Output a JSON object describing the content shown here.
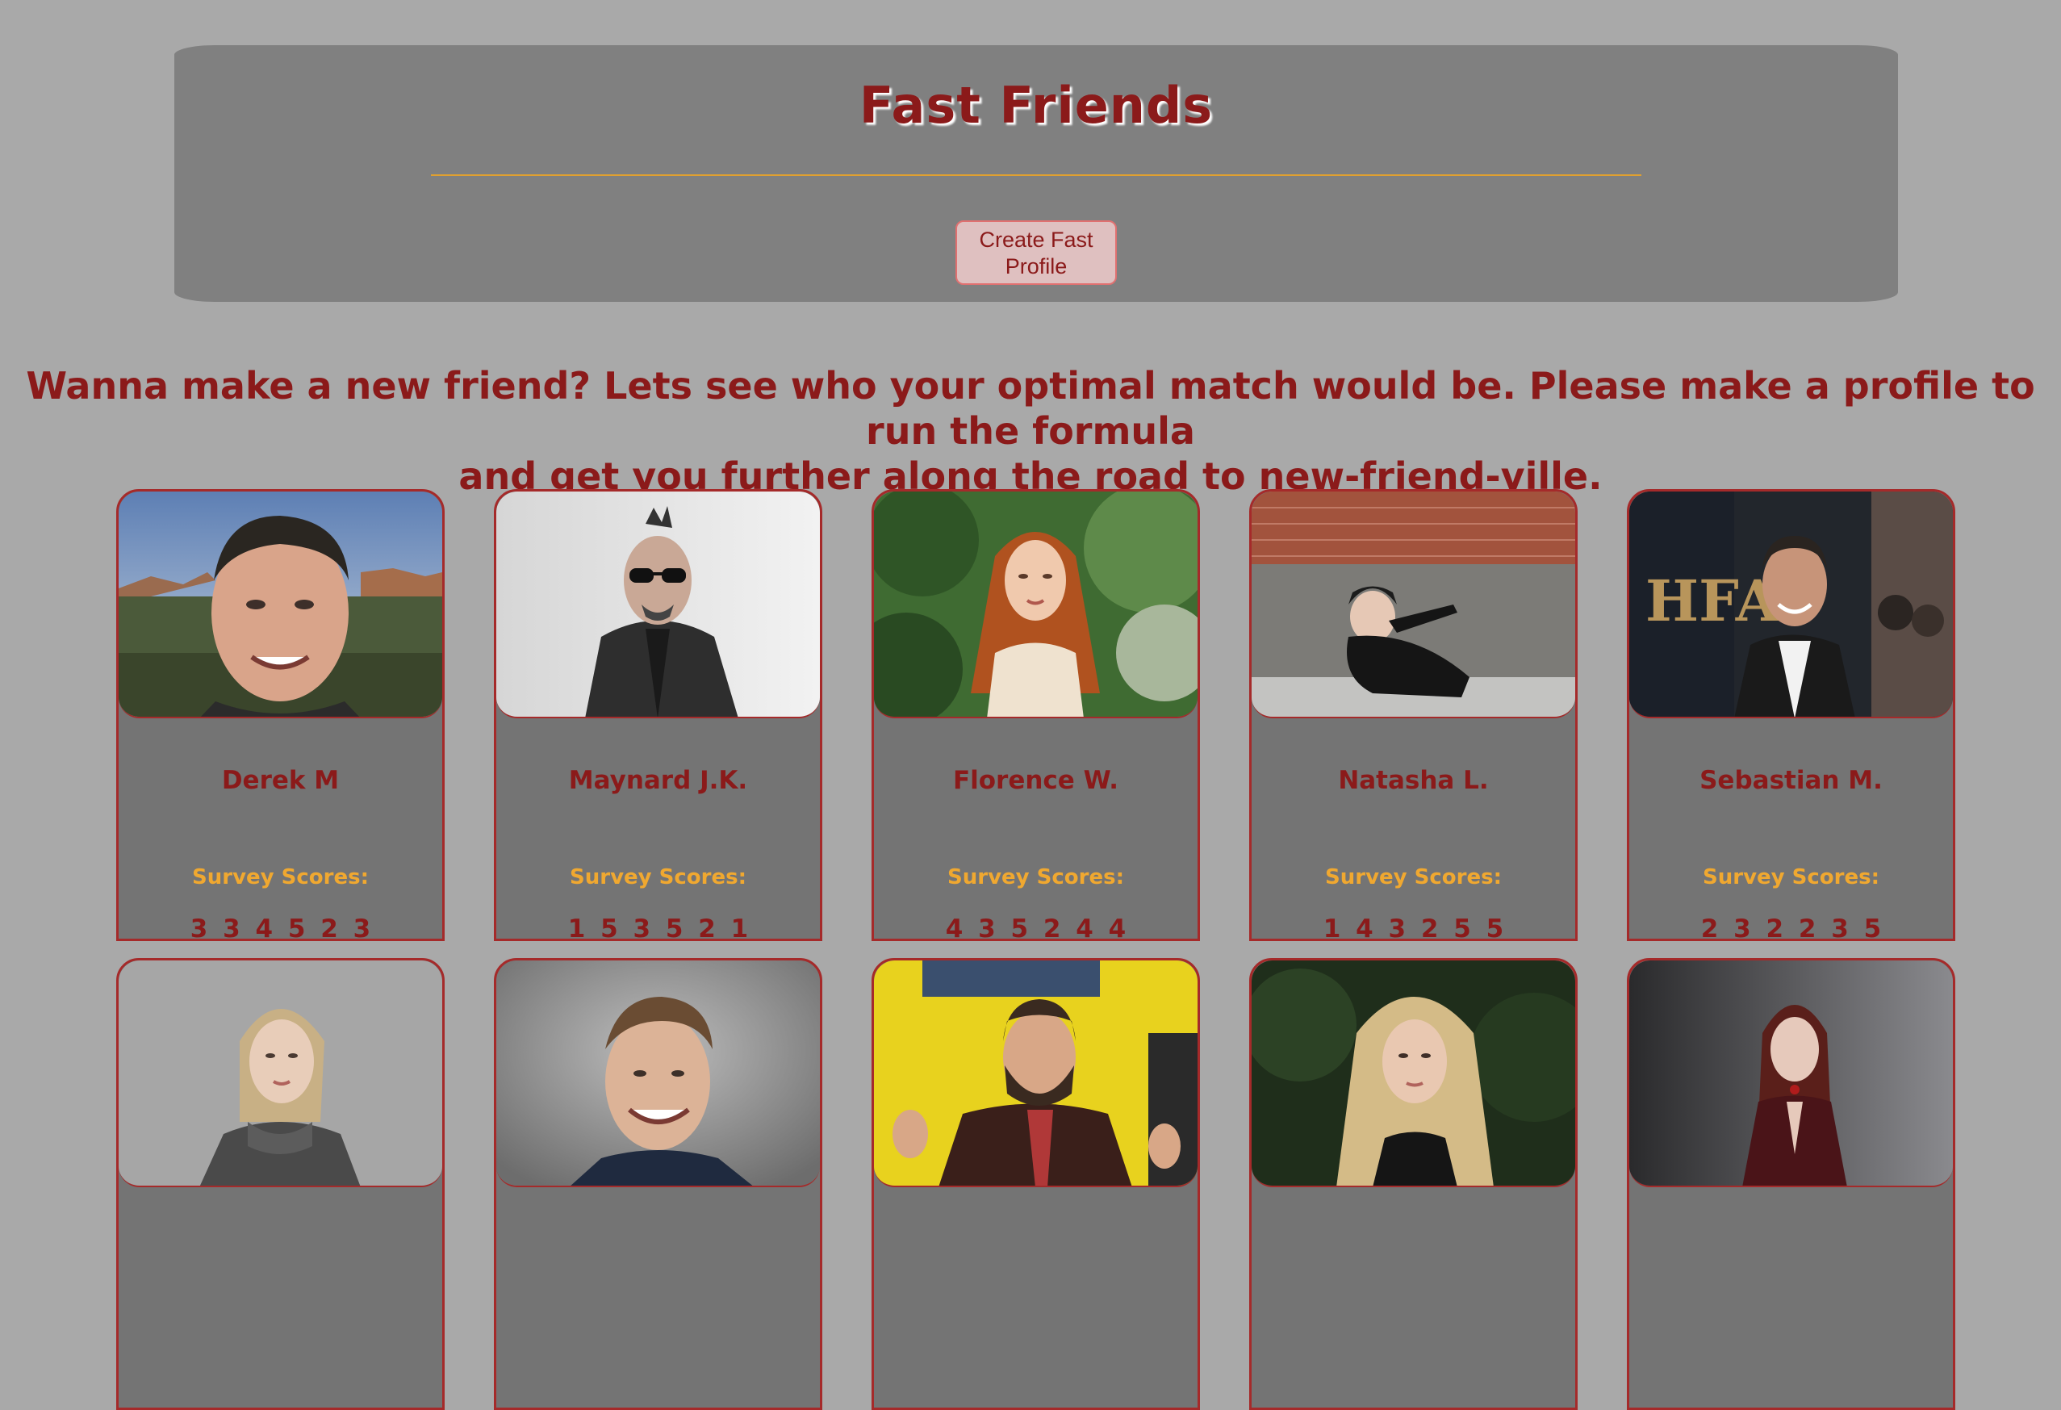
{
  "header": {
    "title": "Fast Friends",
    "create_button_label": "Create Fast Profile"
  },
  "intro": {
    "line1": "Wanna make a new friend? Lets see who your optimal match would be. Please make a profile to run the formula",
    "line2": "and get you further along the road to new-friend-ville."
  },
  "colors": {
    "page_bg": "#a9a9a9",
    "header_bg": "#808080",
    "accent_text": "#8b1a1a",
    "divider": "#e0a030",
    "survey_label": "#f0a830",
    "card_border": "#a52a2a"
  },
  "profiles": [
    {
      "name": "Derek M",
      "survey_label": "Survey Scores:",
      "scores": "3 3 4 5 2 3",
      "photo": "man-smiling-desert-landscape"
    },
    {
      "name": "Maynard J.K.",
      "survey_label": "Survey Scores:",
      "scores": "1 5 3 5 2 1",
      "photo": "man-sunglasses-dark-suit"
    },
    {
      "name": "Florence W.",
      "survey_label": "Survey Scores:",
      "scores": "4 3 5 2 4 4",
      "photo": "woman-red-hair-garden"
    },
    {
      "name": "Natasha L.",
      "survey_label": "Survey Scores:",
      "scores": "1 4 3 2 5 5",
      "photo": "woman-black-dress-brick-wall"
    },
    {
      "name": "Sebastian M.",
      "survey_label": "Survey Scores:",
      "scores": "2 3 2 2 3 5",
      "photo": "man-dark-suit-event"
    },
    {
      "photo": "woman-blonde-gray-sweater"
    },
    {
      "photo": "man-smiling-blazer"
    },
    {
      "photo": "man-beard-yellow-background"
    },
    {
      "photo": "woman-long-blonde-hair"
    },
    {
      "photo": "woman-red-hair-dark-gown"
    }
  ]
}
